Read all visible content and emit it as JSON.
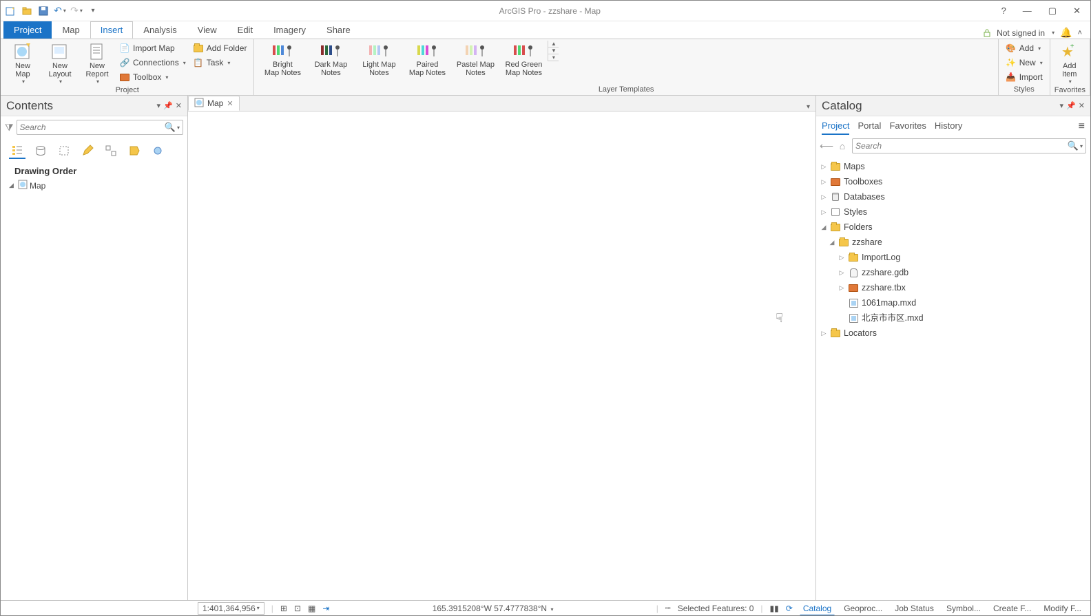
{
  "title": "ArcGIS Pro - zzshare - Map",
  "tabs": {
    "project": "Project",
    "map": "Map",
    "insert": "Insert",
    "analysis": "Analysis",
    "view": "View",
    "edit": "Edit",
    "imagery": "Imagery",
    "share": "Share"
  },
  "signin": "Not signed in",
  "ribbon": {
    "project_grp": "Project",
    "newmap": "New\nMap",
    "newlayout": "New\nLayout",
    "newreport": "New\nReport",
    "importmap": "Import Map",
    "addfolder": "Add Folder",
    "connections": "Connections",
    "task": "Task",
    "toolbox": "Toolbox",
    "layer_templates": "Layer Templates",
    "t1": "Bright\nMap Notes",
    "t2": "Dark Map\nNotes",
    "t3": "Light Map\nNotes",
    "t4": "Paired\nMap Notes",
    "t5": "Pastel Map\nNotes",
    "t6": "Red Green\nMap Notes",
    "styles_grp": "Styles",
    "add": "Add",
    "new": "New",
    "import": "Import",
    "favorites_grp": "Favorites",
    "additem": "Add\nItem"
  },
  "contents": {
    "title": "Contents",
    "search": "Search",
    "drawing": "Drawing Order",
    "map": "Map"
  },
  "doctab": "Map",
  "catalog": {
    "title": "Catalog",
    "tabs": {
      "project": "Project",
      "portal": "Portal",
      "favorites": "Favorites",
      "history": "History"
    },
    "search": "Search",
    "tree": {
      "maps": "Maps",
      "toolboxes": "Toolboxes",
      "databases": "Databases",
      "styles": "Styles",
      "folders": "Folders",
      "zzshare": "zzshare",
      "importlog": "ImportLog",
      "gdb": "zzshare.gdb",
      "tbx": "zzshare.tbx",
      "mxd1": "1061map.mxd",
      "mxd2": "北京市市区.mxd",
      "locators": "Locators"
    }
  },
  "status": {
    "scale": "1:401,364,956",
    "coords": "165.3915208°W 57.4777838°N",
    "selected": "Selected Features: 0",
    "tabs": {
      "catalog": "Catalog",
      "geoproc": "Geoproc...",
      "jobstatus": "Job Status",
      "symbol": "Symbol...",
      "createf": "Create F...",
      "modifyf": "Modify F..."
    }
  }
}
